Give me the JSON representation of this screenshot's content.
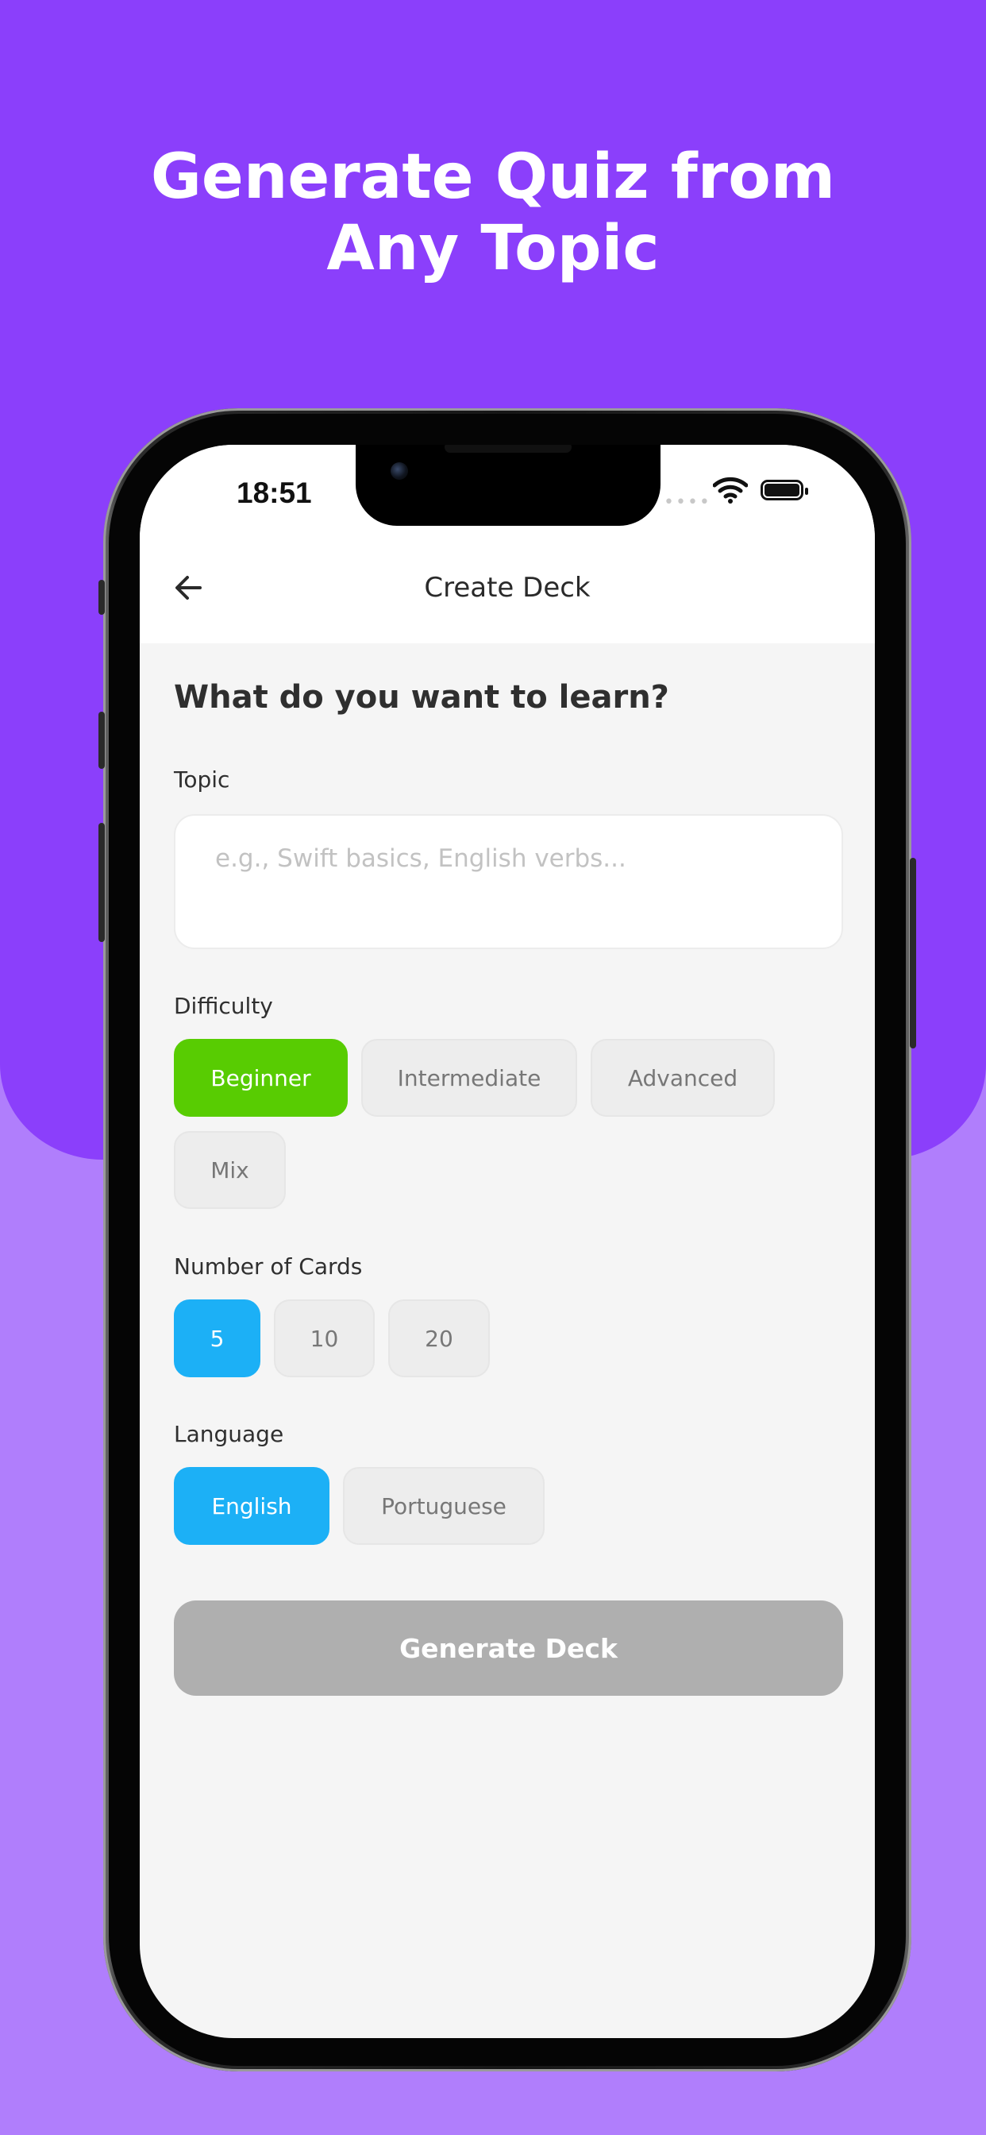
{
  "headline": {
    "line1": "Generate Quiz from",
    "line2": "Any Topic"
  },
  "colors": {
    "background_top": "#8b3ffb",
    "background_bottom": "#b07efc",
    "accent_green": "#58cc02",
    "accent_blue": "#1cb0f6",
    "disabled_button": "#afafaf"
  },
  "status_bar": {
    "time": "18:51",
    "dots": "••••",
    "icons": [
      "wifi-icon",
      "battery-icon"
    ]
  },
  "nav": {
    "back_icon": "arrow-left-icon",
    "title": "Create Deck"
  },
  "form": {
    "question": "What do you want to learn?",
    "topic": {
      "label": "Topic",
      "placeholder": "e.g., Swift basics, English verbs...",
      "value": ""
    },
    "difficulty": {
      "label": "Difficulty",
      "options": [
        "Beginner",
        "Intermediate",
        "Advanced",
        "Mix"
      ],
      "selected": "Beginner"
    },
    "cards": {
      "label": "Number of Cards",
      "options": [
        "5",
        "10",
        "20"
      ],
      "selected": "5"
    },
    "language": {
      "label": "Language",
      "options": [
        "English",
        "Portuguese"
      ],
      "selected": "English"
    },
    "generate_label": "Generate Deck"
  }
}
